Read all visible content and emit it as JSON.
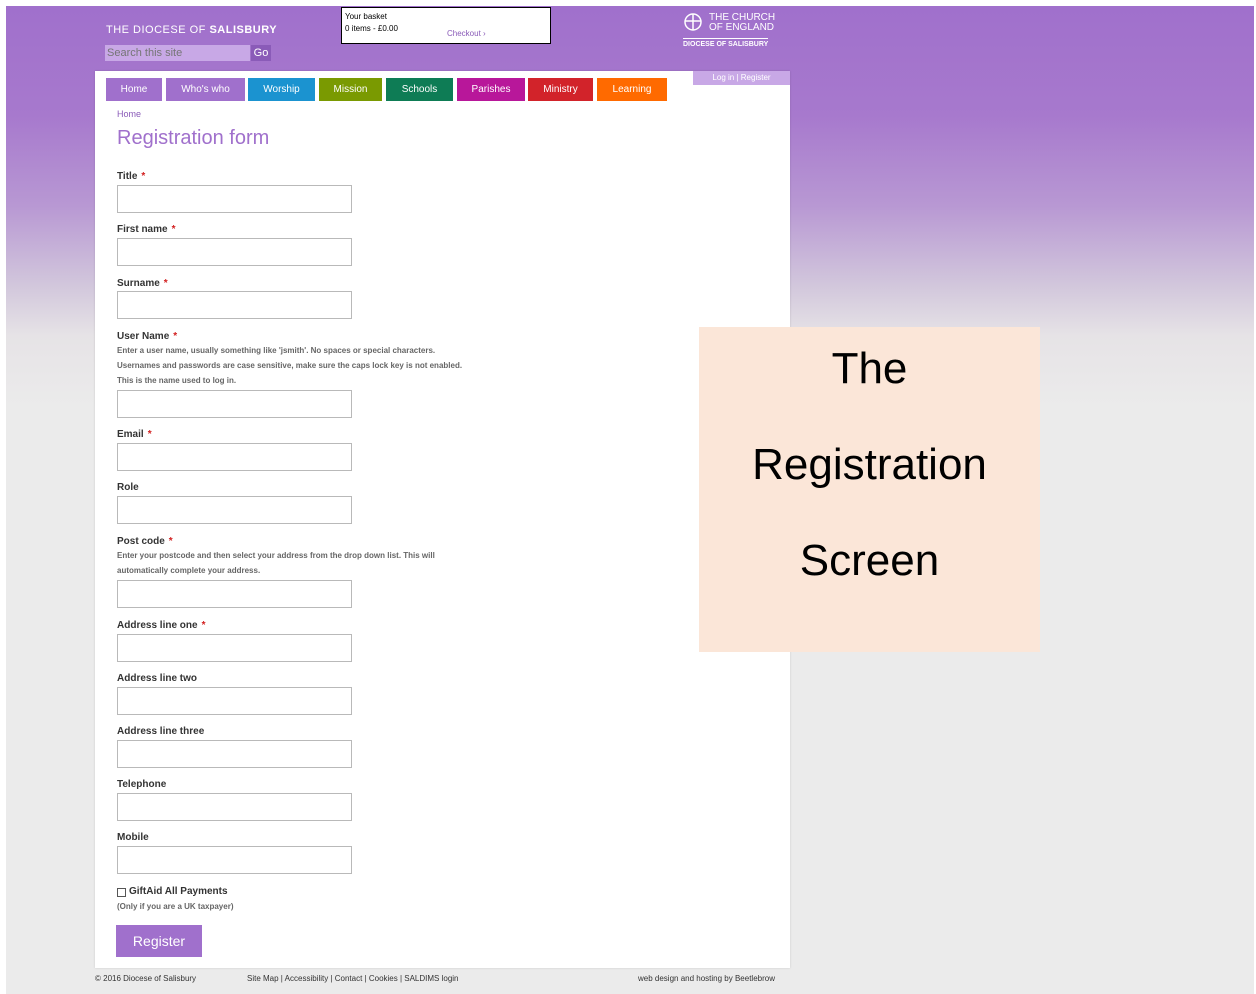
{
  "header": {
    "site_title_prefix": "THE DIOCESE OF",
    "site_title_bold": "SALISBURY",
    "search_placeholder": "Search this site",
    "search_button": "Go",
    "basket_title": "Your basket",
    "basket_summary": "0 items - £0.00",
    "checkout_link": "Checkout ›",
    "church_logo_line1": "THE CHURCH",
    "church_logo_line2": "OF ENGLAND",
    "church_logo_diocese": "DIOCESE OF SALISBURY",
    "login": "Log in",
    "register": "Register"
  },
  "nav": [
    {
      "label": "Home",
      "color": "#a070cc"
    },
    {
      "label": "Who's who",
      "color": "#a070cc"
    },
    {
      "label": "Worship",
      "color": "#1b93d0"
    },
    {
      "label": "Mission",
      "color": "#7a9a01"
    },
    {
      "label": "Schools",
      "color": "#0e7c55"
    },
    {
      "label": "Parishes",
      "color": "#b8179a"
    },
    {
      "label": "Ministry",
      "color": "#d2232a"
    },
    {
      "label": "Learning",
      "color": "#ff6a00"
    }
  ],
  "breadcrumb": "Home",
  "page_title": "Registration form",
  "fields": {
    "title": {
      "label": "Title",
      "required": "*"
    },
    "first_name": {
      "label": "First name",
      "required": "*"
    },
    "surname": {
      "label": "Surname",
      "required": "*"
    },
    "user_name": {
      "label": "User Name",
      "required": "*",
      "help1": "Enter a user name, usually something like 'jsmith'. No spaces or special characters.",
      "help2": "Usernames and passwords are case sensitive, make sure the caps lock key is not enabled.",
      "help3": "This is the name used to log in."
    },
    "email": {
      "label": "Email",
      "required": "*"
    },
    "role": {
      "label": "Role"
    },
    "post_code": {
      "label": "Post code",
      "required": "*",
      "help1": "Enter your postcode and then select your address from the drop down list. This will",
      "help2": "automatically complete your address."
    },
    "address1": {
      "label": "Address line one",
      "required": "*"
    },
    "address2": {
      "label": "Address line two"
    },
    "address3": {
      "label": "Address line three"
    },
    "telephone": {
      "label": "Telephone"
    },
    "mobile": {
      "label": "Mobile"
    }
  },
  "giftaid": {
    "label": "GiftAid All Payments",
    "note": "(Only if you are a UK taxpayer)",
    "checked": false
  },
  "register_button": "Register",
  "footer": {
    "copyright": "© 2016 Diocese of Salisbury",
    "links": "Site Map | Accessibility | Contact | Cookies | SALDIMS login",
    "credit": "web design and hosting by Beetlebrow"
  },
  "overlay": {
    "line1": "The",
    "line2": "Registration",
    "line3": "Screen"
  }
}
